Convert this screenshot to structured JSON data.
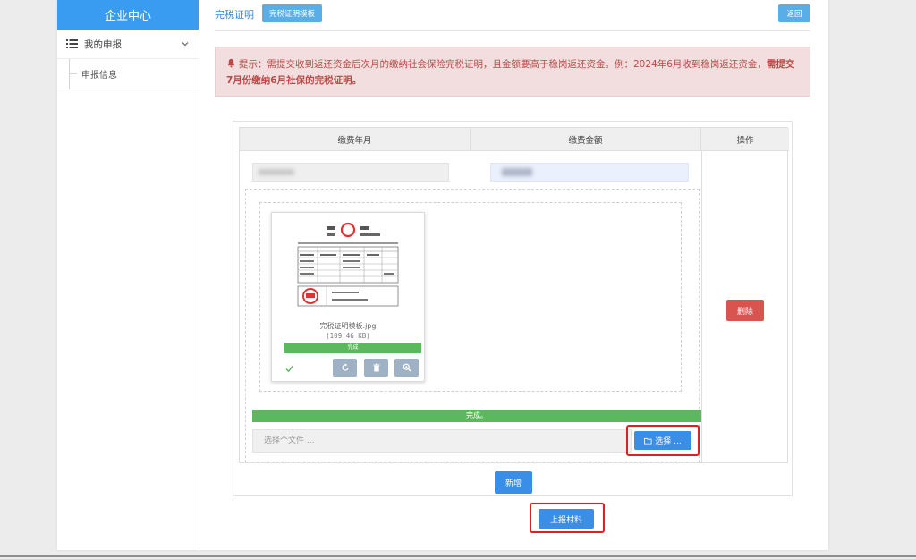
{
  "sidebar": {
    "title": "企业中心",
    "group_label": "我的申报",
    "items": [
      {
        "label": "申报信息"
      }
    ]
  },
  "header": {
    "title": "完税证明",
    "template_button": "完税证明模板",
    "back_button": "返回"
  },
  "alert": {
    "text_normal": "提示：需提交收到返还资金后次月的缴纳社会保险完税证明，且金额要高于稳岗返还资金。例：2024年6月收到稳岗返还资金，",
    "text_bold": "需提交7月份缴纳6月社保的完税证明。"
  },
  "table": {
    "columns": [
      "缴费年月",
      "缴费金额",
      "操作"
    ],
    "delete_button": "删除"
  },
  "upload": {
    "file_name": "完税证明模板.jpg",
    "file_size": "(109.46 KB)",
    "card_progress_text": "完成",
    "progress_text": "完成。",
    "progress": 1.0,
    "file_input_placeholder": "选择个文件 ...",
    "choose_button": "选择 ..."
  },
  "actions": {
    "add_button": "新增",
    "submit_button": "上报材料"
  },
  "colors": {
    "primary": "#3a8ee6",
    "sidebar_header": "#3a9cf0",
    "success": "#5cb85c",
    "danger": "#d9534f",
    "alert_bg": "#f2dede",
    "alert_text": "#b94a48",
    "highlight": "#e02020"
  }
}
